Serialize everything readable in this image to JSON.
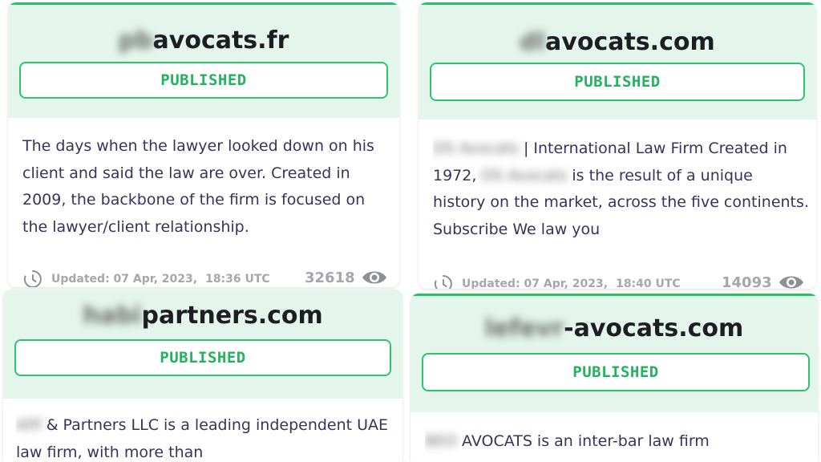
{
  "cards": [
    {
      "domain_hidden": "pb",
      "domain_visible": "avocats.fr",
      "status": "PUBLISHED",
      "description_hidden_lead": "",
      "description": "The days when the lawyer looked down on his client and said the law are over. Created in 2009, the backbone of the firm is focused on the lawyer/client relationship.",
      "updated_label": "Updated: 07 Apr, 2023,",
      "updated_time": "18:36 UTC",
      "views": "32618"
    },
    {
      "domain_hidden": "dl",
      "domain_visible": "avocats.com",
      "status": "PUBLISHED",
      "description_hidden_lead": "DS Avocats",
      "description_part1": " | International Law Firm Created in 1972, ",
      "description_hidden_mid": "DS Avocats",
      "description_part2": " is the result of a unique history on the market, across the five continents. Subscribe We law you",
      "updated_label": "Updated: 07 Apr, 2023,",
      "updated_time": "18:40 UTC",
      "views": "14093"
    },
    {
      "domain_hidden": "habi",
      "domain_visible": "partners.com",
      "status": "PUBLISHED",
      "description_hidden_lead": "Afif",
      "description": " & Partners LLC is a leading independent UAE law firm, with more than"
    },
    {
      "domain_hidden": "lefevr",
      "domain_visible": "-avocats.com",
      "status": "PUBLISHED",
      "description_hidden_lead": "BEO",
      "description": " AVOCATS is an inter-bar law firm"
    }
  ],
  "colors": {
    "accent_green": "#25c06a",
    "header_bg": "#e4f6ec",
    "text_dark": "#34345c",
    "muted": "#a6a6ae"
  },
  "icons": {
    "updated": "clock-icon",
    "views": "eye-icon"
  }
}
